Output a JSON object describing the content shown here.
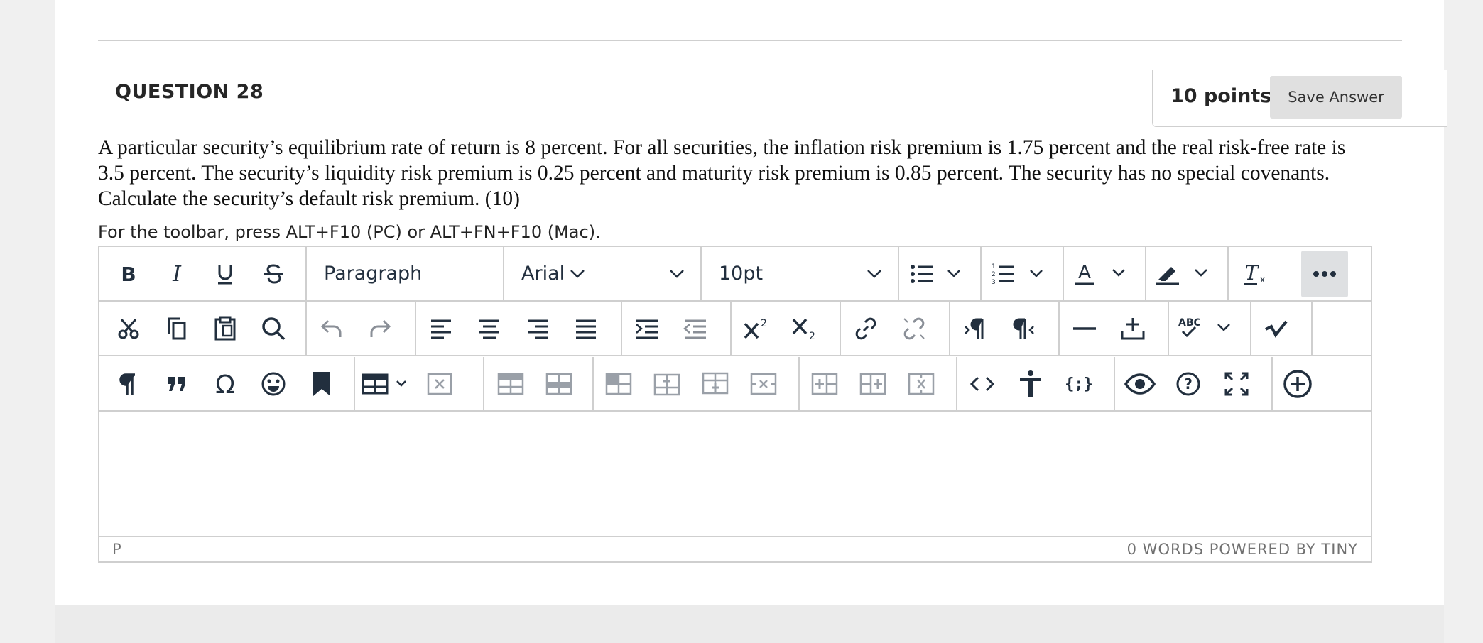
{
  "question": {
    "title": "QUESTION 28",
    "points": "10 points",
    "save_label": "Save Answer",
    "text": "A particular security’s equilibrium rate of return is 8 percent. For all securities, the inflation risk premium is 1.75 percent and the real risk-free rate is 3.5 percent. The security’s liquidity risk premium is 0.25 percent and maturity risk premium is 0.85 percent. The security has no special covenants. Calculate the security’s default risk premium. (10)",
    "toolbar_hint": "For the toolbar, press ALT+F10 (PC) or ALT+FN+F10 (Mac)."
  },
  "editor": {
    "block_format": "Paragraph",
    "font_family": "Arial",
    "font_size": "10pt",
    "path": "P",
    "status": "0 WORDS  POWERED BY TINY",
    "colors": {
      "border": "#cfcfcf",
      "icon": "#222f3e",
      "more_bg": "#dee0e2"
    }
  }
}
